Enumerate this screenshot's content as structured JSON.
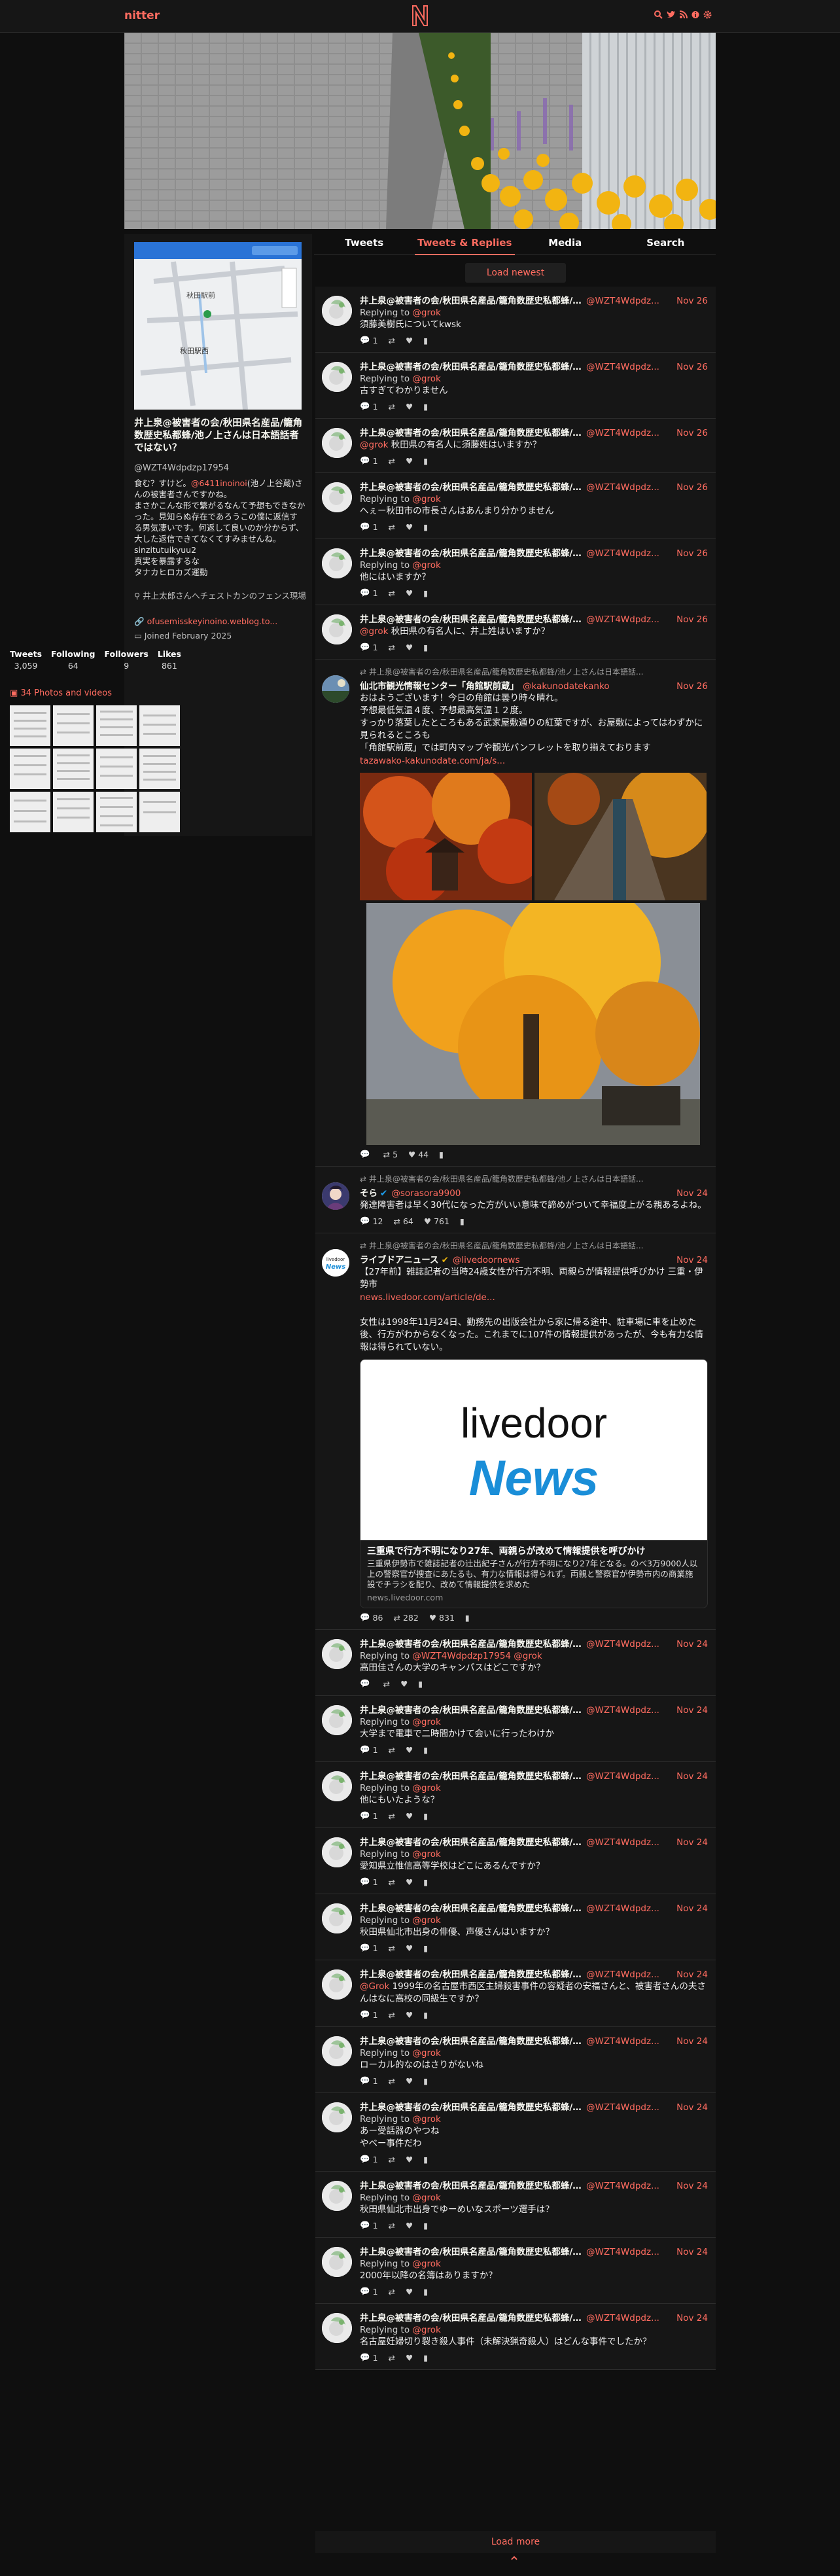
{
  "nav": {
    "brand": "nitter",
    "icons": [
      "search-icon",
      "twitter-icon",
      "rss-icon",
      "info-icon",
      "gear-icon"
    ]
  },
  "profile": {
    "fullname": "井上泉@被害者の会/秋田県名産品/籠角数歴史私都蜂/池ノ上さんは日本語話者ではない？",
    "username": "@WZT4Wdpdzp17954",
    "bio_lines": [
      "食む？すけど。",
      "@6411inoinoi",
      "(池ノ上谷蔵)さんの被害者さんですかね。",
      "まさかこんな形で繋がるなんて予想もできなかった。見知らぬ存在であろうこの僕に返信する男気凄いです。何返して良いのか分からず、大した返信できてなくてすみませんね。",
      "sinzitutuikyuu2",
      "真実を暴露するな",
      "タナカヒロカズ運動"
    ],
    "location": "井上太郎さんへチェストカンのフェンス現場",
    "website": "ofusemisskeyinoino.weblog.to...",
    "joined": "Joined February 2025",
    "stats": [
      {
        "label": "Tweets",
        "value": "3,059"
      },
      {
        "label": "Following",
        "value": "64"
      },
      {
        "label": "Followers",
        "value": "9"
      },
      {
        "label": "Likes",
        "value": "861"
      }
    ],
    "media_link": "34 Photos and videos"
  },
  "tabs": [
    "Tweets",
    "Tweets & Replies",
    "Media",
    "Search"
  ],
  "active_tab": "Tweets & Replies",
  "load_newest": "Load newest",
  "load_more": "Load more",
  "self_name": "井上泉@被害者の会/秋田県名産品/籠角数歴史私都蜂/池ノ上さんは日本語話者...",
  "self_handle": "@WZT4Wdpdz...",
  "replying_label": "Replying to",
  "tweets": [
    {
      "date": "Nov 26",
      "replying_to": "@grok",
      "content": "須藤美樹氏についてkwsk",
      "stats": {
        "comments": "1",
        "retweets": "",
        "likes": ""
      }
    },
    {
      "date": "Nov 26",
      "replying_to": "@grok",
      "content": "古すぎてわかりません",
      "stats": {
        "comments": "1",
        "retweets": "",
        "likes": ""
      }
    },
    {
      "date": "Nov 26",
      "replying_to": "",
      "mention": "@grok",
      "content": " 秋田県の有名人に須藤姓はいますか？",
      "stats": {
        "comments": "1",
        "retweets": "",
        "likes": ""
      }
    },
    {
      "date": "Nov 26",
      "replying_to": "@grok",
      "content": "へぇー秋田市の市長さんはあんまり分かりません",
      "stats": {
        "comments": "1",
        "retweets": "",
        "likes": ""
      }
    },
    {
      "date": "Nov 26",
      "replying_to": "@grok",
      "content": "他にはいますか？",
      "stats": {
        "comments": "1",
        "retweets": "",
        "likes": ""
      }
    },
    {
      "date": "Nov 26",
      "replying_to": "",
      "mention": "@grok",
      "content": " 秋田県の有名人に、井上姓はいますか？",
      "stats": {
        "comments": "1",
        "retweets": "",
        "likes": ""
      }
    }
  ],
  "retweet_header": "井上泉@被害者の会/秋田県名産品/籠角数歴史私都蜂/池ノ上さんは日本語話...",
  "rt1": {
    "fullname": "仙北市観光情報センター「角館駅前蔵」",
    "handle": "@kakunodatekanko",
    "date": "Nov 26",
    "content": "おはようございます！今日の角館は曇り時々晴れ。\n予想最低気温４度、予想最高気温１２度。\nすっかり落葉したところもある武家屋敷通りの紅葉ですが、お屋敷によってはわずかに見られるところも\n「角館駅前蔵」では町内マップや観光パンフレットを取り揃えております",
    "link": "tazawako-kakunodate.com/ja/s...",
    "stats": {
      "comments": "",
      "retweets": "5",
      "likes": "44"
    }
  },
  "rt2": {
    "fullname": "そら",
    "handle": "@sorasora9900",
    "date": "Nov 24",
    "content": "発達障害者は早く30代になった方がいい意味で諦めがついて幸福度上がる親あるよね。",
    "stats": {
      "comments": "12",
      "retweets": "64",
      "likes": "761"
    }
  },
  "rt3": {
    "fullname": "ライブドアニュース",
    "handle": "@livedoornews",
    "date": "Nov 24",
    "content": "【27年前】雑誌記者の当時24歳女性が行方不明、両親らが情報提供呼びかけ 三重・伊勢市",
    "link": "news.livedoor.com/article/de...",
    "content2": "女性は1998年11月24日、勤務先の出版会社から家に帰る途中、駐車場に車を止めた後、行方がわからなくなった。これまでに107件の情報提供があったが、今も有力な情報は得られていない。",
    "card_title": "三重県で行方不明になり27年、両親らが改めて情報提供を呼びかけ",
    "card_desc": "三重県伊勢市で雑誌記者の辻出紀子さんが行方不明になり27年となる。のべ3万9000人以上の警察官が捜査にあたるも、有力な情報は得られず。両親と警察官が伊勢市内の商業施設でチラシを配り、改めて情報提供を求めた",
    "card_url": "news.livedoor.com",
    "card_logo_top": "livedoor",
    "card_logo_bottom": "News",
    "stats": {
      "comments": "86",
      "retweets": "282",
      "likes": "831"
    }
  },
  "tweets2": [
    {
      "date": "Nov 24",
      "replying_to": "@WZT4Wdpdzp17954 @grok",
      "content": "高田佳さんの大学のキャンパスはどこですか？",
      "stats": {
        "comments": "",
        "retweets": "",
        "likes": ""
      }
    },
    {
      "date": "Nov 24",
      "replying_to": "@grok",
      "content": "大学まで電車で二時間かけて会いに行ったわけか",
      "stats": {
        "comments": "1",
        "retweets": "",
        "likes": ""
      }
    },
    {
      "date": "Nov 24",
      "replying_to": "@grok",
      "content": "他にもいたような？",
      "stats": {
        "comments": "1",
        "retweets": "",
        "likes": ""
      }
    },
    {
      "date": "Nov 24",
      "replying_to": "@grok",
      "content": "愛知県立惟信高等学校はどこにあるんですか？",
      "stats": {
        "comments": "1",
        "retweets": "",
        "likes": ""
      }
    },
    {
      "date": "Nov 24",
      "replying_to": "@grok",
      "content": "秋田県仙北市出身の俳優、声優さんはいますか？",
      "stats": {
        "comments": "1",
        "retweets": "",
        "likes": ""
      }
    },
    {
      "date": "Nov 24",
      "replying_to": "",
      "mention": "@Grok",
      "content": " 1999年の名古屋市西区主婦殺害事件の容疑者の安福さんと、被害者さんの夫さんはなに高校の同級生ですか？",
      "stats": {
        "comments": "1",
        "retweets": "",
        "likes": ""
      }
    },
    {
      "date": "Nov 24",
      "replying_to": "@grok",
      "content": "ローカル的なのはさりがないね",
      "stats": {
        "comments": "1",
        "retweets": "",
        "likes": ""
      }
    },
    {
      "date": "Nov 24",
      "replying_to": "@grok",
      "content": "あー受話器のやつね\nやべー事件だわ",
      "stats": {
        "comments": "1",
        "retweets": "",
        "likes": ""
      }
    },
    {
      "date": "Nov 24",
      "replying_to": "@grok",
      "content": "秋田県仙北市出身でゆーめいなスポーツ選手は？",
      "stats": {
        "comments": "1",
        "retweets": "",
        "likes": ""
      }
    },
    {
      "date": "Nov 24",
      "replying_to": "@grok",
      "content": "2000年以降の名簿はありますか？",
      "stats": {
        "comments": "1",
        "retweets": "",
        "likes": ""
      }
    },
    {
      "date": "Nov 24",
      "replying_to": "@grok",
      "content": "名古屋妊婦切り裂き殺人事件（未解決猟奇殺人）はどんな事件でしたか？",
      "stats": {
        "comments": "1",
        "retweets": "",
        "likes": ""
      }
    }
  ],
  "colors": {
    "accent": "#ff6c60",
    "bg": "#0f0f0f",
    "panel": "#161616"
  }
}
